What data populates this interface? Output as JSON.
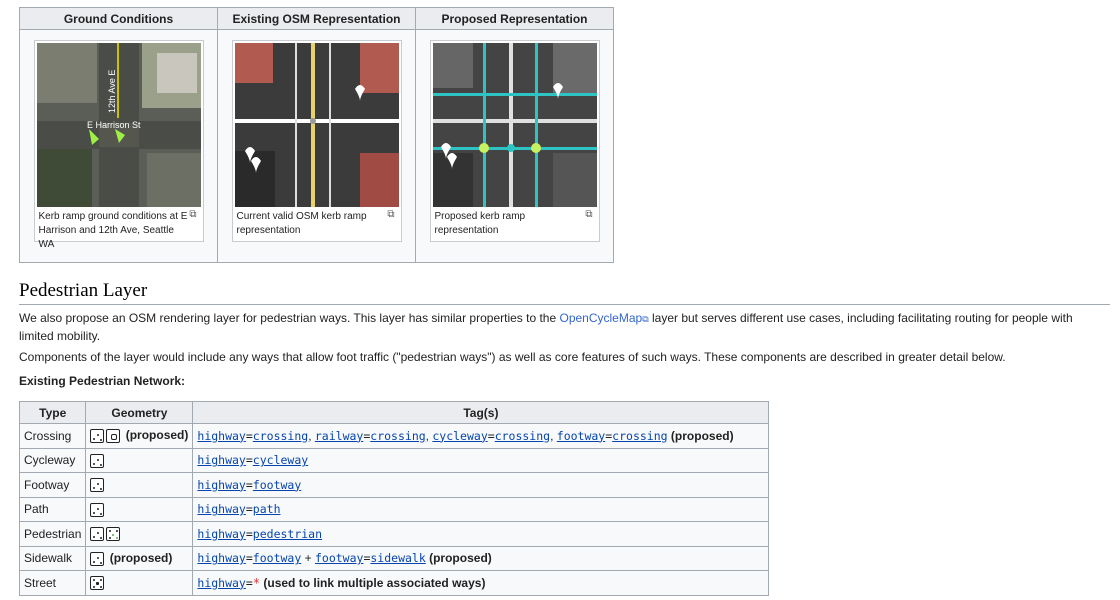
{
  "gallery": {
    "headers": [
      "Ground Conditions",
      "Existing OSM Representation",
      "Proposed Representation"
    ],
    "captions": [
      "Kerb ramp ground conditions at E Harrison and 12th Ave, Seattle WA",
      "Current valid OSM kerb ramp representation",
      "Proposed kerb ramp representation"
    ],
    "map_labels": {
      "avenue": "12th Ave E",
      "street": "E Harrison St"
    },
    "magnify_icon": "magnify-icon"
  },
  "section": {
    "title": "Pedestrian Layer",
    "para1_pre": "We also propose an OSM rendering layer for pedestrian ways. This layer has similar properties to the ",
    "para1_link": "OpenCycleMap",
    "para1_post": " layer but serves different use cases, including facilitating routing for people with limited mobility.",
    "para2": "Components of the layer would include any ways that allow foot traffic (\"pedestrian ways\") as well as core features of such ways. These components are described in greater detail below.",
    "subhead": "Existing Pedestrian Network:"
  },
  "table": {
    "headers": [
      "Type",
      "Geometry",
      "Tag(s)"
    ],
    "rows": [
      {
        "type": "Crossing",
        "geom_note": "(proposed)"
      },
      {
        "type": "Cycleway",
        "geom_note": ""
      },
      {
        "type": "Footway",
        "geom_note": ""
      },
      {
        "type": "Path",
        "geom_note": ""
      },
      {
        "type": "Pedestrian",
        "geom_note": ""
      },
      {
        "type": "Sidewalk",
        "geom_note": "(proposed)"
      },
      {
        "type": "Street",
        "geom_note": ""
      }
    ],
    "tags": {
      "highway": "highway",
      "railway": "railway",
      "cycleway": "cycleway",
      "footway": "footway",
      "crossing": "crossing",
      "cycleway_v": "cycleway",
      "footway_v": "footway",
      "path": "path",
      "pedestrian": "pedestrian",
      "sidewalk": "sidewalk",
      "eq": "=",
      "comma": ",",
      "plus": "+",
      "star": "*",
      "proposed": "(proposed)",
      "street_note": "(used to link multiple associated ways)"
    }
  },
  "colors": {
    "link": "#3366cc",
    "tag_key": "#0645ad",
    "header_bg": "#eaecf0",
    "cell_bg": "#f8f9fa",
    "proposed_way": "#2ec4c4",
    "proposed_node": "#c8f060"
  }
}
